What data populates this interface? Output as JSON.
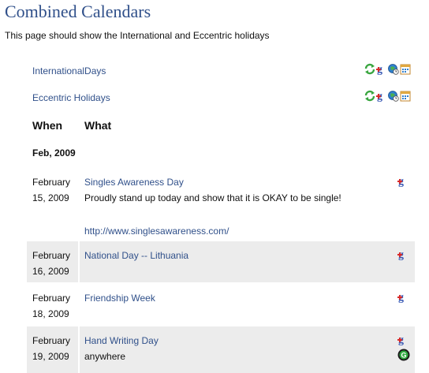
{
  "page": {
    "title": "Combined Calendars",
    "subtitle": "This page should show the International and Eccentric holidays"
  },
  "calendars": [
    {
      "name": "InternationalDays"
    },
    {
      "name": "Eccentric Holidays"
    }
  ],
  "table": {
    "when_header": "When",
    "what_header": "What",
    "month_group": "Feb, 2009"
  },
  "events": [
    {
      "date_line1": "February",
      "date_line2": "15, 2009",
      "title": "Singles Awareness Day",
      "description": "Proudly stand up today and show that it is OKAY to be single!",
      "link": "http://www.singlesawareness.com/"
    },
    {
      "date_line1": "February",
      "date_line2": "16, 2009",
      "title": "National Day -- Lithuania"
    },
    {
      "date_line1": "February",
      "date_line2": "18, 2009",
      "title": "Friendship Week"
    },
    {
      "date_line1": "February",
      "date_line2": "19, 2009",
      "title": "Hand Writing Day",
      "location": "anywhere"
    }
  ],
  "icons": {
    "sync": "refresh-icon",
    "google": "google-calendar-icon",
    "clock": "clock-icon",
    "calendar": "calendar-icon",
    "map": "map-icon"
  },
  "colors": {
    "link": "#30508a",
    "row_shade": "#ececec"
  }
}
